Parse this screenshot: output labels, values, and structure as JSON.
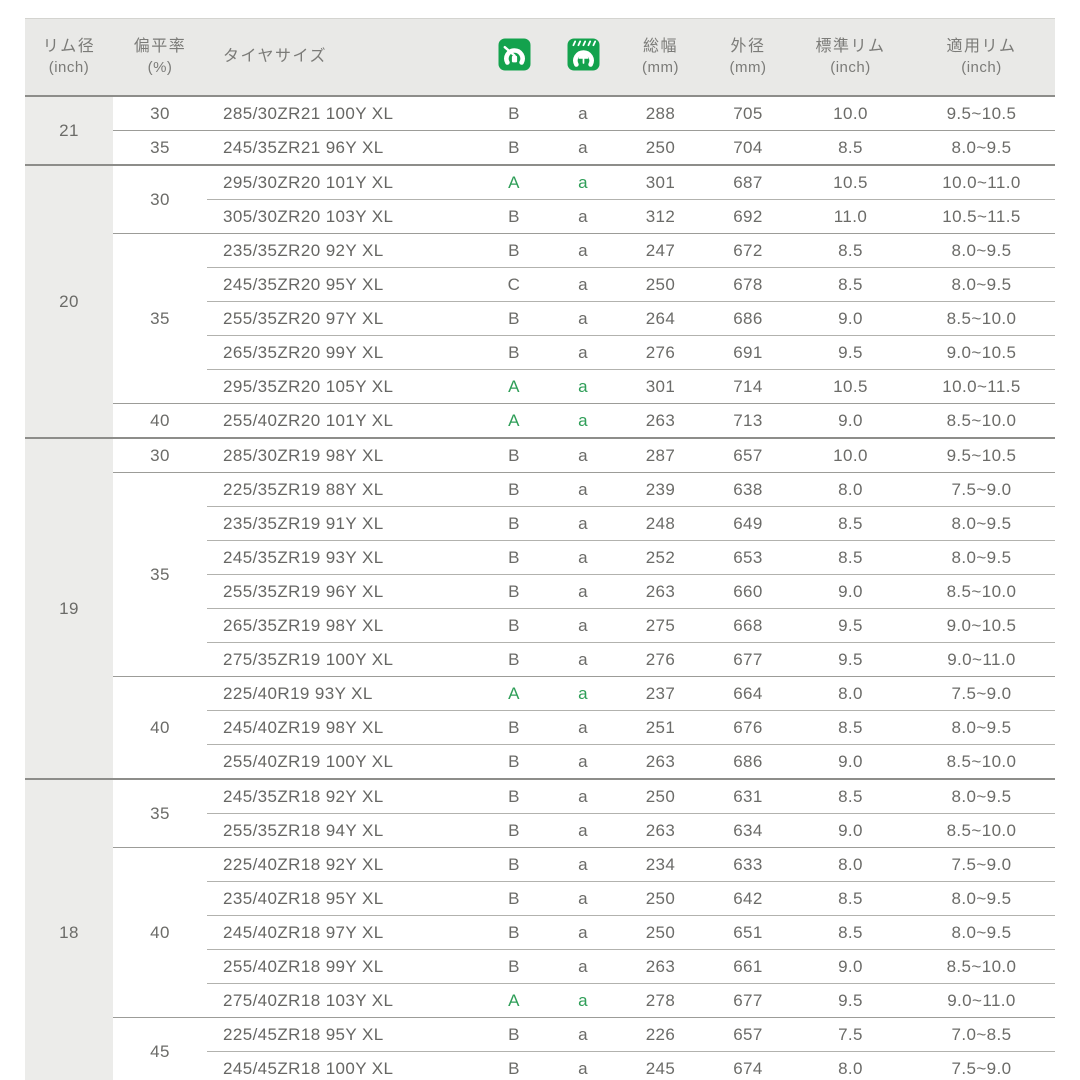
{
  "table": {
    "colors": {
      "accent_green": "#2f9e58",
      "icon_green": "#13a24d",
      "header_bg": "#e9e9e7",
      "rim_column_bg": "#ececea",
      "text_gray": "#6b6b68"
    },
    "headers": {
      "rim_diameter": {
        "line1": "リム径",
        "line2": "(inch)"
      },
      "aspect_ratio": {
        "line1": "偏平率",
        "line2": "(%)"
      },
      "tire_size": "タイヤサイズ",
      "fuel_icon": "fuel-efficiency-rating-icon",
      "wet_icon": "wet-grip-rating-icon",
      "total_width": {
        "line1": "総幅",
        "line2": "(mm)"
      },
      "outer_diameter": {
        "line1": "外径",
        "line2": "(mm)"
      },
      "standard_rim": {
        "line1": "標準リム",
        "line2": "(inch)"
      },
      "applicable_rim": {
        "line1": "適用リム",
        "line2": "(inch)"
      }
    },
    "sections": [
      {
        "rim": "21",
        "groups": [
          {
            "aspect": "30",
            "rows": [
              {
                "size": "285/30ZR21 100Y XL",
                "fuel": "B",
                "wet": "a",
                "total_width": "288",
                "outer_diameter": "705",
                "standard_rim": "10.0",
                "applicable_rim": "9.5~10.5",
                "green": false
              }
            ]
          },
          {
            "aspect": "35",
            "rows": [
              {
                "size": "245/35ZR21 96Y XL",
                "fuel": "B",
                "wet": "a",
                "total_width": "250",
                "outer_diameter": "704",
                "standard_rim": "8.5",
                "applicable_rim": "8.0~9.5",
                "green": false
              }
            ]
          }
        ]
      },
      {
        "rim": "20",
        "groups": [
          {
            "aspect": "30",
            "rows": [
              {
                "size": "295/30ZR20 101Y XL",
                "fuel": "A",
                "wet": "a",
                "total_width": "301",
                "outer_diameter": "687",
                "standard_rim": "10.5",
                "applicable_rim": "10.0~11.0",
                "green": true
              },
              {
                "size": "305/30ZR20 103Y XL",
                "fuel": "B",
                "wet": "a",
                "total_width": "312",
                "outer_diameter": "692",
                "standard_rim": "11.0",
                "applicable_rim": "10.5~11.5",
                "green": false
              }
            ]
          },
          {
            "aspect": "35",
            "rows": [
              {
                "size": "235/35ZR20 92Y XL",
                "fuel": "B",
                "wet": "a",
                "total_width": "247",
                "outer_diameter": "672",
                "standard_rim": "8.5",
                "applicable_rim": "8.0~9.5",
                "green": false
              },
              {
                "size": "245/35ZR20 95Y XL",
                "fuel": "C",
                "wet": "a",
                "total_width": "250",
                "outer_diameter": "678",
                "standard_rim": "8.5",
                "applicable_rim": "8.0~9.5",
                "green": false
              },
              {
                "size": "255/35ZR20 97Y XL",
                "fuel": "B",
                "wet": "a",
                "total_width": "264",
                "outer_diameter": "686",
                "standard_rim": "9.0",
                "applicable_rim": "8.5~10.0",
                "green": false
              },
              {
                "size": "265/35ZR20 99Y XL",
                "fuel": "B",
                "wet": "a",
                "total_width": "276",
                "outer_diameter": "691",
                "standard_rim": "9.5",
                "applicable_rim": "9.0~10.5",
                "green": false
              },
              {
                "size": "295/35ZR20 105Y XL",
                "fuel": "A",
                "wet": "a",
                "total_width": "301",
                "outer_diameter": "714",
                "standard_rim": "10.5",
                "applicable_rim": "10.0~11.5",
                "green": true
              }
            ]
          },
          {
            "aspect": "40",
            "rows": [
              {
                "size": "255/40ZR20 101Y XL",
                "fuel": "A",
                "wet": "a",
                "total_width": "263",
                "outer_diameter": "713",
                "standard_rim": "9.0",
                "applicable_rim": "8.5~10.0",
                "green": true
              }
            ]
          }
        ]
      },
      {
        "rim": "19",
        "groups": [
          {
            "aspect": "30",
            "rows": [
              {
                "size": "285/30ZR19 98Y XL",
                "fuel": "B",
                "wet": "a",
                "total_width": "287",
                "outer_diameter": "657",
                "standard_rim": "10.0",
                "applicable_rim": "9.5~10.5",
                "green": false
              }
            ]
          },
          {
            "aspect": "35",
            "rows": [
              {
                "size": "225/35ZR19 88Y XL",
                "fuel": "B",
                "wet": "a",
                "total_width": "239",
                "outer_diameter": "638",
                "standard_rim": "8.0",
                "applicable_rim": "7.5~9.0",
                "green": false
              },
              {
                "size": "235/35ZR19 91Y XL",
                "fuel": "B",
                "wet": "a",
                "total_width": "248",
                "outer_diameter": "649",
                "standard_rim": "8.5",
                "applicable_rim": "8.0~9.5",
                "green": false
              },
              {
                "size": "245/35ZR19 93Y XL",
                "fuel": "B",
                "wet": "a",
                "total_width": "252",
                "outer_diameter": "653",
                "standard_rim": "8.5",
                "applicable_rim": "8.0~9.5",
                "green": false
              },
              {
                "size": "255/35ZR19 96Y XL",
                "fuel": "B",
                "wet": "a",
                "total_width": "263",
                "outer_diameter": "660",
                "standard_rim": "9.0",
                "applicable_rim": "8.5~10.0",
                "green": false
              },
              {
                "size": "265/35ZR19 98Y XL",
                "fuel": "B",
                "wet": "a",
                "total_width": "275",
                "outer_diameter": "668",
                "standard_rim": "9.5",
                "applicable_rim": "9.0~10.5",
                "green": false
              },
              {
                "size": "275/35ZR19 100Y XL",
                "fuel": "B",
                "wet": "a",
                "total_width": "276",
                "outer_diameter": "677",
                "standard_rim": "9.5",
                "applicable_rim": "9.0~11.0",
                "green": false
              }
            ]
          },
          {
            "aspect": "40",
            "rows": [
              {
                "size": "225/40R19 93Y XL",
                "fuel": "A",
                "wet": "a",
                "total_width": "237",
                "outer_diameter": "664",
                "standard_rim": "8.0",
                "applicable_rim": "7.5~9.0",
                "green": true
              },
              {
                "size": "245/40ZR19 98Y XL",
                "fuel": "B",
                "wet": "a",
                "total_width": "251",
                "outer_diameter": "676",
                "standard_rim": "8.5",
                "applicable_rim": "8.0~9.5",
                "green": false
              },
              {
                "size": "255/40ZR19 100Y XL",
                "fuel": "B",
                "wet": "a",
                "total_width": "263",
                "outer_diameter": "686",
                "standard_rim": "9.0",
                "applicable_rim": "8.5~10.0",
                "green": false
              }
            ]
          }
        ]
      },
      {
        "rim": "18",
        "groups": [
          {
            "aspect": "35",
            "rows": [
              {
                "size": "245/35ZR18 92Y XL",
                "fuel": "B",
                "wet": "a",
                "total_width": "250",
                "outer_diameter": "631",
                "standard_rim": "8.5",
                "applicable_rim": "8.0~9.5",
                "green": false
              },
              {
                "size": "255/35ZR18 94Y XL",
                "fuel": "B",
                "wet": "a",
                "total_width": "263",
                "outer_diameter": "634",
                "standard_rim": "9.0",
                "applicable_rim": "8.5~10.0",
                "green": false
              }
            ]
          },
          {
            "aspect": "40",
            "rows": [
              {
                "size": "225/40ZR18 92Y XL",
                "fuel": "B",
                "wet": "a",
                "total_width": "234",
                "outer_diameter": "633",
                "standard_rim": "8.0",
                "applicable_rim": "7.5~9.0",
                "green": false
              },
              {
                "size": "235/40ZR18 95Y XL",
                "fuel": "B",
                "wet": "a",
                "total_width": "250",
                "outer_diameter": "642",
                "standard_rim": "8.5",
                "applicable_rim": "8.0~9.5",
                "green": false
              },
              {
                "size": "245/40ZR18 97Y XL",
                "fuel": "B",
                "wet": "a",
                "total_width": "250",
                "outer_diameter": "651",
                "standard_rim": "8.5",
                "applicable_rim": "8.0~9.5",
                "green": false
              },
              {
                "size": "255/40ZR18 99Y XL",
                "fuel": "B",
                "wet": "a",
                "total_width": "263",
                "outer_diameter": "661",
                "standard_rim": "9.0",
                "applicable_rim": "8.5~10.0",
                "green": false
              },
              {
                "size": "275/40ZR18 103Y XL",
                "fuel": "A",
                "wet": "a",
                "total_width": "278",
                "outer_diameter": "677",
                "standard_rim": "9.5",
                "applicable_rim": "9.0~11.0",
                "green": true
              }
            ]
          },
          {
            "aspect": "45",
            "rows": [
              {
                "size": "225/45ZR18 95Y XL",
                "fuel": "B",
                "wet": "a",
                "total_width": "226",
                "outer_diameter": "657",
                "standard_rim": "7.5",
                "applicable_rim": "7.0~8.5",
                "green": false
              },
              {
                "size": "245/45ZR18 100Y XL",
                "fuel": "B",
                "wet": "a",
                "total_width": "245",
                "outer_diameter": "674",
                "standard_rim": "8.0",
                "applicable_rim": "7.5~9.0",
                "green": false
              }
            ]
          }
        ]
      }
    ]
  }
}
